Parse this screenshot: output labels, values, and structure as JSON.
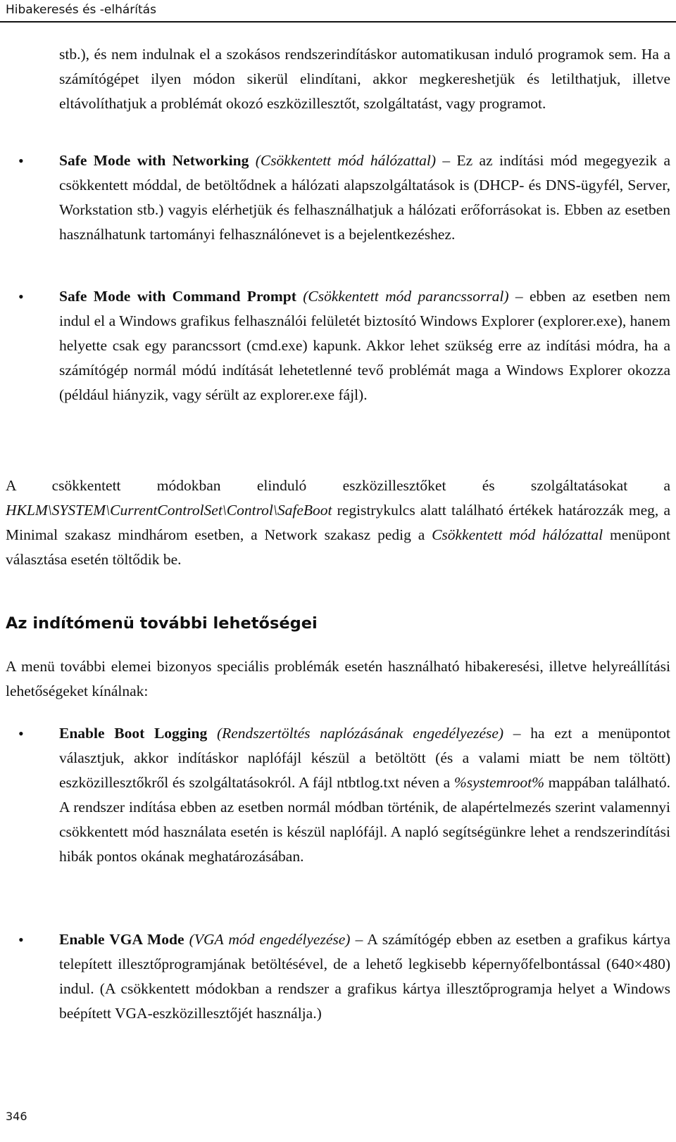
{
  "header": {
    "running_title": "Hibakeresés és -elhárítás"
  },
  "continuation_text": "stb.), és nem indulnak el a szokásos rendszerindításkor automatikusan induló programok sem. Ha a számítógépet ilyen módon sikerül elindítani, akkor megkereshetjük és letilthatjuk, illetve eltávolíthatjuk a problémát okozó eszközillesztőt, szolgáltatást, vagy programot.",
  "safe_mode_items": [
    {
      "title": "Safe Mode with Networking",
      "translation": "(Csökkentett mód hálózattal)",
      "body": " – Ez az indítási mód megegyezik a csökkentett móddal, de betöltődnek a hálózati alapszolgáltatások is (DHCP- és DNS-ügyfél, Server, Workstation stb.) vagyis elérhetjük és felhasználhatjuk a hálózati erőforrásokat is. Ebben az esetben használhatunk tartományi felhasználónevet is a bejelentkezéshez."
    },
    {
      "title": "Safe Mode with Command Prompt",
      "translation": "(Csökkentett mód parancssorral)",
      "body": " – ebben az esetben nem indul el a Windows grafikus felhasználói felületét biztosító Windows Explorer (explorer.exe), hanem helyette csak egy parancssort (cmd.exe) kapunk. Akkor lehet szükség erre az indítási módra, ha a számítógép normál módú indítását lehetetlenné tevő problémát maga a Windows Explorer okozza (például hiányzik, vagy sérült az explorer.exe fájl)."
    }
  ],
  "registry_paragraph": {
    "before": "A csökkentett módokban elinduló eszközillesztőket és szolgáltatásokat a ",
    "registry_key": "HKLM\\SYSTEM\\CurrentControlSet\\Control\\SafeBoot",
    "middle": " registrykulcs alatt található értékek határozzák meg, a Minimal szakasz mindhárom esetben, a Network szakasz pedig a ",
    "menu_item": "Csökkentett mód hálózattal",
    "after": " menüpont választása esetén töltődik be."
  },
  "section": {
    "heading": "Az indítómenü további lehetőségei",
    "intro": "A menü további elemei bizonyos speciális problémák esetén használható hibakeresési, illetve helyreállítási lehetőségeket kínálnak:"
  },
  "extra_items": [
    {
      "title": "Enable Boot Logging",
      "translation": "(Rendszertöltés naplózásának engedélyezése)",
      "body_before": " – ha ezt a menüpontot választjuk, akkor indításkor naplófájl készül a betöltött (és a valami miatt be nem töltött) eszközillesztőkről és szolgáltatásokról. A fájl ntbtlog.txt néven a ",
      "path_var": "%systemroot%",
      "body_after": " mappában található. A rendszer indítása ebben az esetben normál módban történik, de alapértelmezés szerint valamennyi csökkentett mód használata esetén is készül naplófájl. A napló segítségünkre lehet a rendszerindítási hibák pontos okának meghatározásában."
    },
    {
      "title": "Enable VGA Mode",
      "translation": "(VGA mód engedélyezése)",
      "body": " – A számítógép ebben az esetben a grafikus kártya telepített illesztőprogramjának betöltésével, de a lehető legkisebb képernyőfelbontással (640×480) indul. (A csökkentett módokban a rendszer a grafikus kártya illesztőprogramja helyet a Windows beépített VGA-eszközillesztőjét használja.)"
    }
  ],
  "footer": {
    "page_number": "346"
  },
  "bullet_glyph": "•"
}
